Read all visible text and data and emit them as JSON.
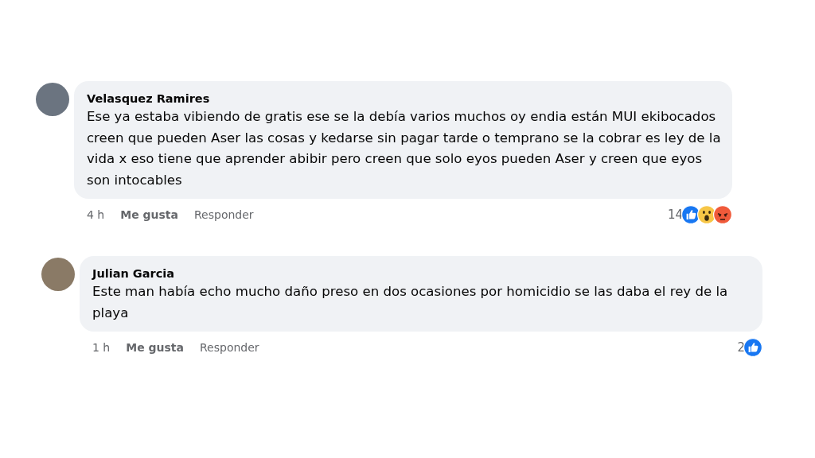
{
  "comments": [
    {
      "author": "Velasquez Ramires",
      "text": "Ese ya estaba vibiendo de gratis ese se la debía varios muchos oy endia están MUI ekibocados creen que pueden Aser las cosas y kedarse sin pagar tarde o temprano se la cobrar es ley de la vida x eso tiene que aprender abibir pero creen que solo eyos pueden Aser y creen que eyos son intocables",
      "time": "4 h",
      "like": "Me gusta",
      "reply": "Responder",
      "reaction_count": "14",
      "reactions": [
        {
          "kind": "like"
        },
        {
          "kind": "wow"
        },
        {
          "kind": "angry"
        }
      ]
    },
    {
      "author": "Julian Garcia",
      "text": "Este man había echo mucho daño preso en dos ocasiones por homicidio se las daba el rey de la playa",
      "time": "1 h",
      "like": "Me gusta",
      "reply": "Responder",
      "reaction_count": "2",
      "reactions": [
        {
          "kind": "like"
        }
      ]
    }
  ]
}
